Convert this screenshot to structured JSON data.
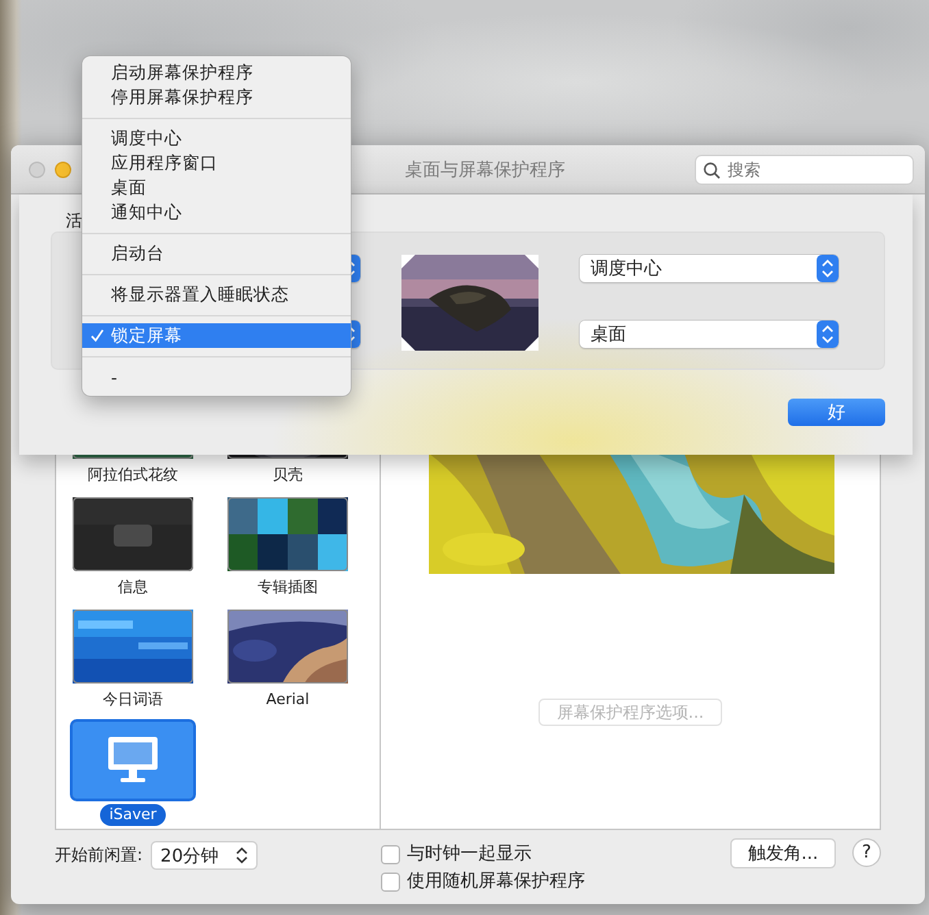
{
  "window": {
    "title": "桌面与屏幕保护程序",
    "search_placeholder": "搜索"
  },
  "screen_savers": [
    {
      "name": "阿拉伯式花纹",
      "kind": "pattern",
      "selected": false
    },
    {
      "name": "贝壳",
      "kind": "shell",
      "selected": false
    },
    {
      "name": "信息",
      "kind": "message",
      "selected": false
    },
    {
      "name": "专辑插图",
      "kind": "mosaic",
      "selected": false
    },
    {
      "name": "今日词语",
      "kind": "words",
      "selected": false
    },
    {
      "name": "Aerial",
      "kind": "earth",
      "selected": false
    },
    {
      "name": "iSaver",
      "kind": "monitor",
      "selected": true
    }
  ],
  "preview": {
    "options_button": {
      "label": "屏幕保护程序选项...",
      "disabled": true
    }
  },
  "idle": {
    "label": "开始前闲置:",
    "value": "20分钟"
  },
  "options": [
    {
      "label": "与时钟一起显示",
      "checked": false
    },
    {
      "label": "使用随机屏幕保护程序",
      "checked": false
    }
  ],
  "hot_corners_button": "触发角...",
  "help_button": "?",
  "sheet": {
    "label": "活",
    "right_popups": [
      {
        "value": "调度中心"
      },
      {
        "value": "桌面"
      }
    ],
    "ok_button": "好"
  },
  "menu": {
    "groups": [
      [
        {
          "label": "启动屏幕保护程序",
          "selected": false,
          "checked": false
        },
        {
          "label": "停用屏幕保护程序",
          "selected": false,
          "checked": false
        }
      ],
      [
        {
          "label": "调度中心",
          "selected": false,
          "checked": false
        },
        {
          "label": "应用程序窗口",
          "selected": false,
          "checked": false
        },
        {
          "label": "桌面",
          "selected": false,
          "checked": false
        },
        {
          "label": "通知中心",
          "selected": false,
          "checked": false
        }
      ],
      [
        {
          "label": "启动台",
          "selected": false,
          "checked": false
        }
      ],
      [
        {
          "label": "将显示器置入睡眠状态",
          "selected": false,
          "checked": false
        }
      ],
      [
        {
          "label": "锁定屏幕",
          "selected": true,
          "checked": true
        }
      ],
      [
        {
          "label": "-",
          "selected": false,
          "checked": false
        }
      ]
    ]
  }
}
